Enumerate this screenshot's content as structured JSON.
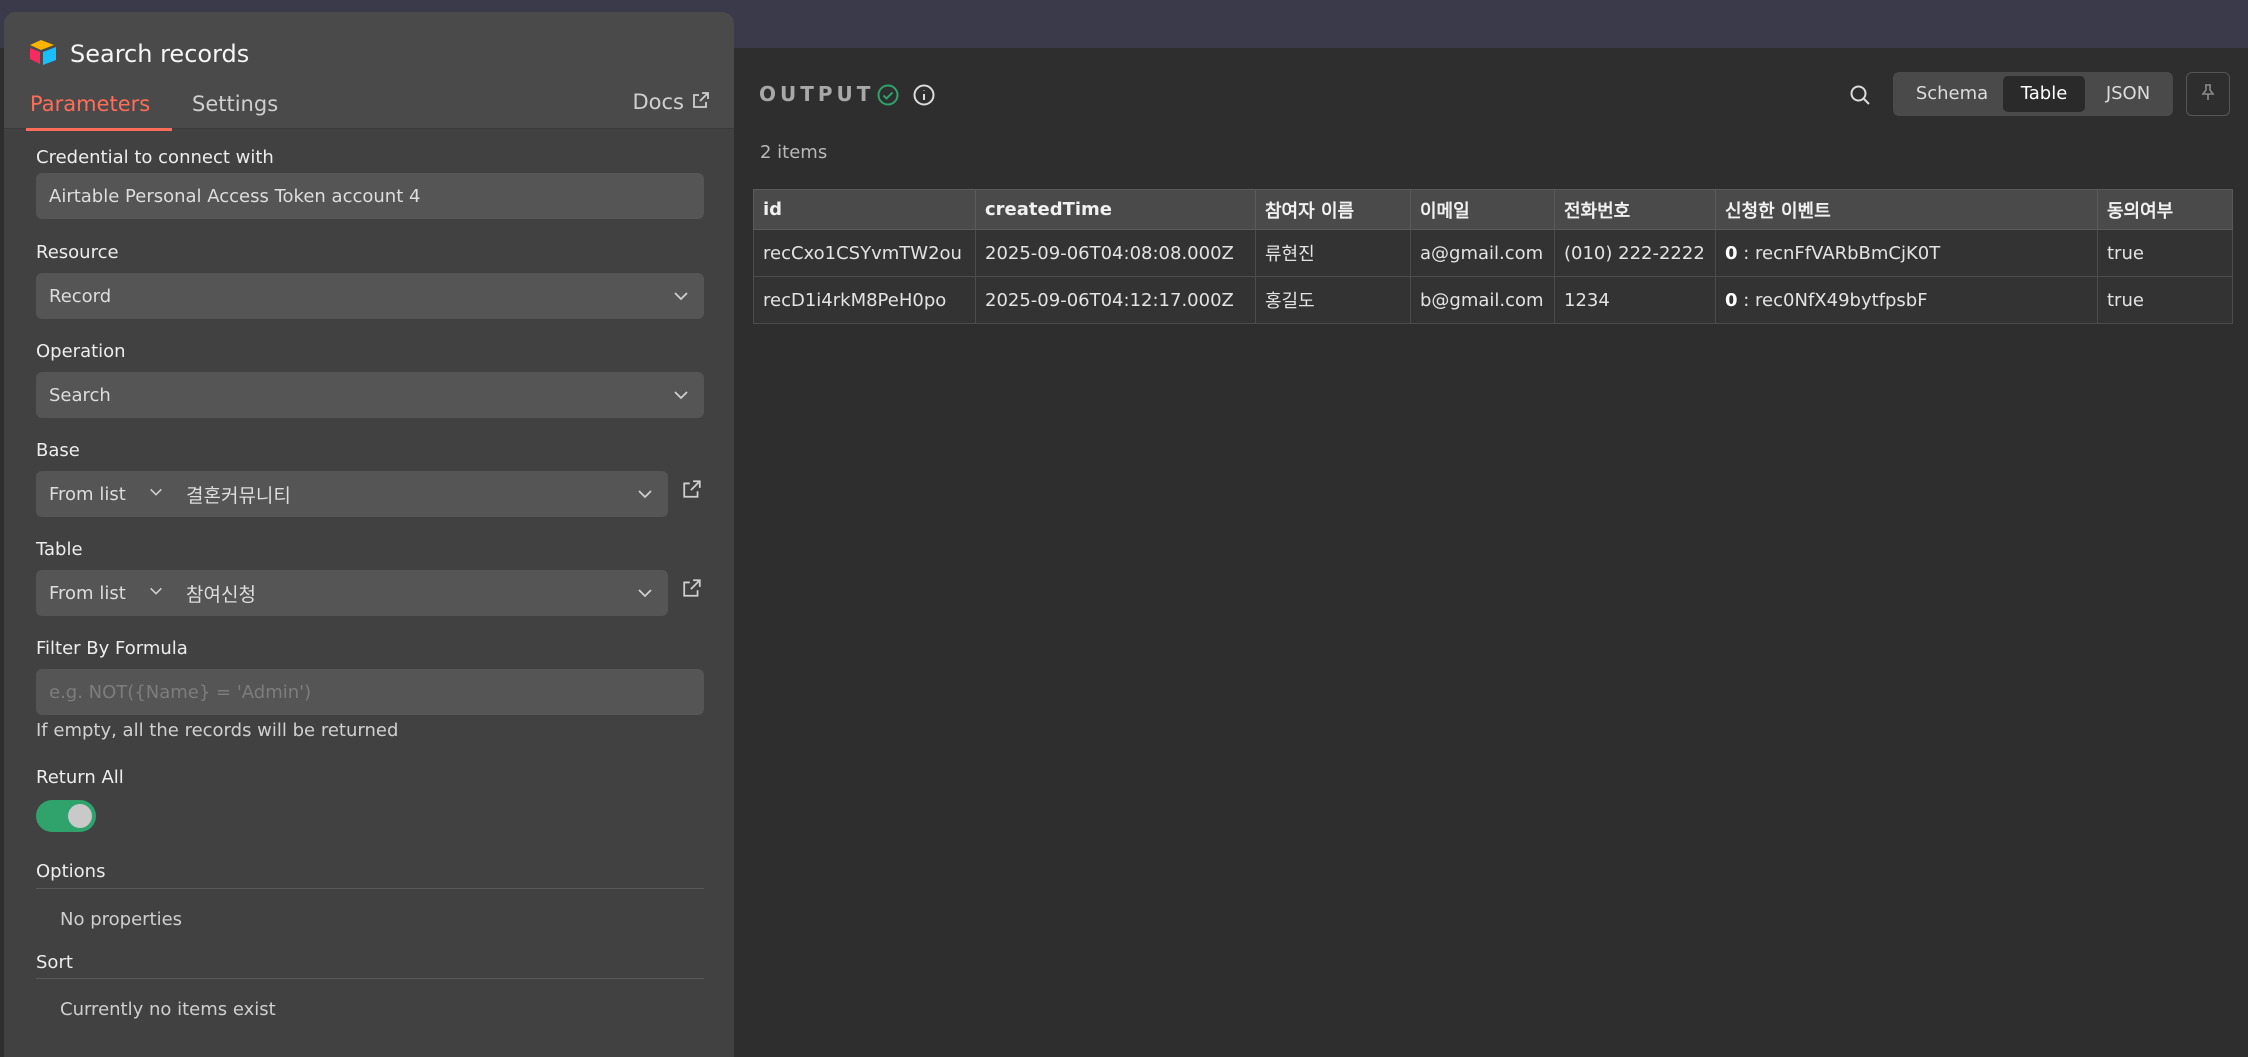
{
  "node": {
    "title": "Search records",
    "icon": "airtable-logo-icon"
  },
  "tabs": {
    "parameters": "Parameters",
    "settings": "Settings",
    "docs": "Docs"
  },
  "fields": {
    "credential": {
      "label": "Credential to connect with",
      "value": "Airtable Personal Access Token account 4"
    },
    "resource": {
      "label": "Resource",
      "value": "Record"
    },
    "operation": {
      "label": "Operation",
      "value": "Search"
    },
    "base": {
      "label": "Base",
      "mode": "From list",
      "value": "결혼커뮤니티"
    },
    "table": {
      "label": "Table",
      "mode": "From list",
      "value": "참여신청"
    },
    "filter": {
      "label": "Filter By Formula",
      "placeholder": "e.g. NOT({Name} = 'Admin')",
      "hint": "If empty, all the records will be returned"
    },
    "return_all": {
      "label": "Return All",
      "enabled": true
    },
    "options": {
      "label": "Options",
      "empty_text": "No properties"
    },
    "sort": {
      "label": "Sort",
      "empty_text": "Currently no items exist"
    }
  },
  "output": {
    "title": "OUTPUT",
    "items_count": "2 items",
    "views": [
      "Schema",
      "Table",
      "JSON"
    ],
    "active_view": "Table",
    "columns": [
      "id",
      "createdTime",
      "참여자 이름",
      "이메일",
      "전화번호",
      "신청한 이벤트",
      "동의여부"
    ],
    "rows": [
      {
        "id": "recCxo1CSYvmTW2ou",
        "createdTime": "2025-09-06T04:08:08.000Z",
        "name": "류현진",
        "email": "a@gmail.com",
        "phone": "(010) 222-2222",
        "event_index": "0",
        "event_value": ": recnFfVARbBmCjK0T",
        "consent": "true"
      },
      {
        "id": "recD1i4rkM8PeH0po",
        "createdTime": "2025-09-06T04:12:17.000Z",
        "name": "홍길도",
        "email": "b@gmail.com",
        "phone": "1234",
        "event_index": "0",
        "event_value": ": rec0NfX49bytfpsbF",
        "consent": "true"
      }
    ]
  },
  "colors": {
    "accent": "#ff6d5a",
    "success": "#2fa36b",
    "panel": "#414141",
    "background": "#2e2e2e"
  }
}
